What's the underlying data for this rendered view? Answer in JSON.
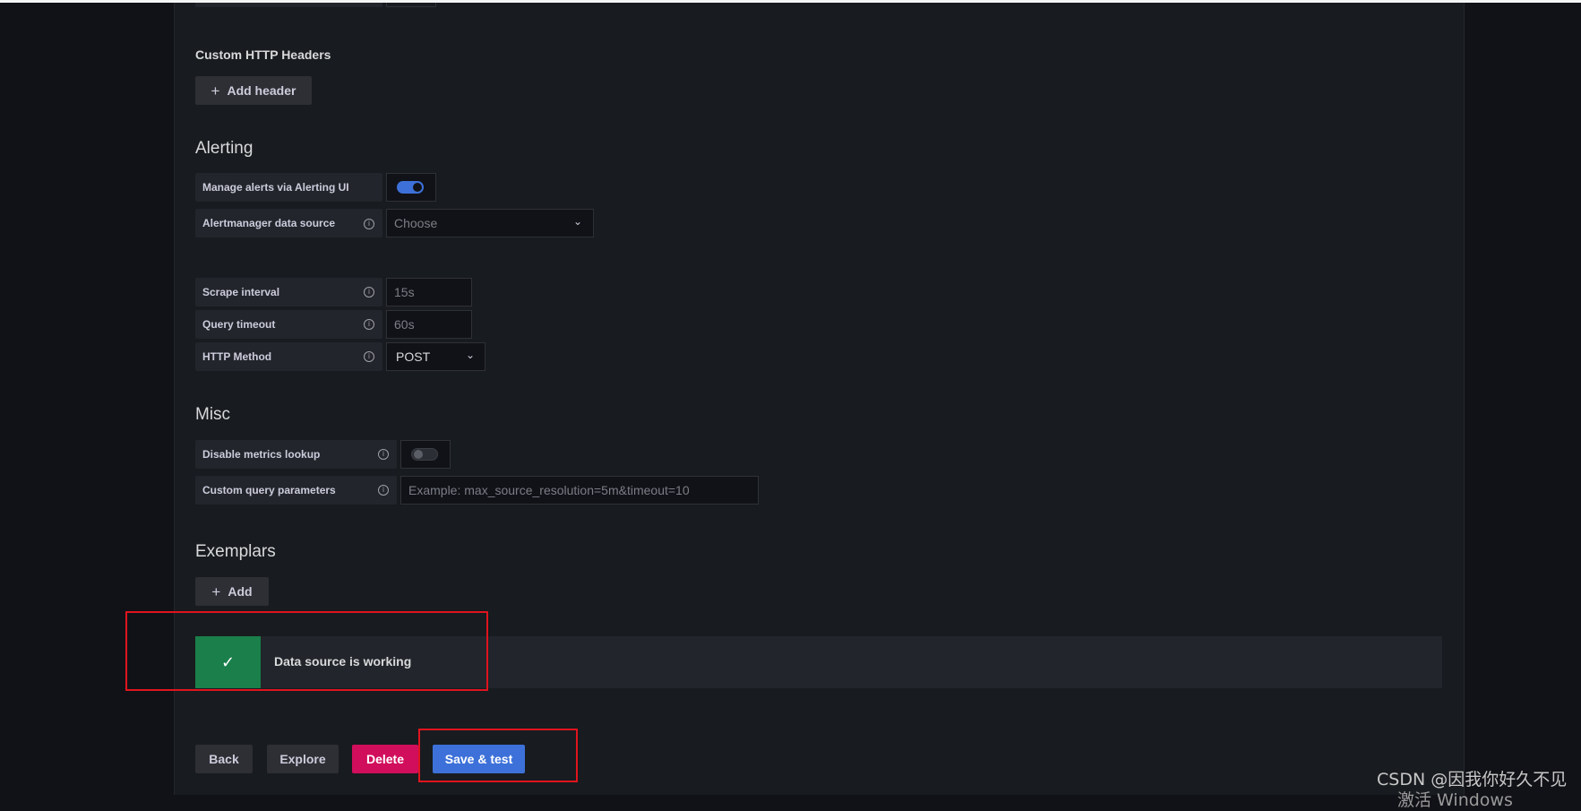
{
  "custom_headers": {
    "title": "Custom HTTP Headers",
    "add_label": "Add header"
  },
  "alerting": {
    "title": "Alerting",
    "manage_label": "Manage alerts via Alerting UI",
    "manage_enabled": true,
    "alertmanager_label": "Alertmanager data source",
    "alertmanager_placeholder": "Choose"
  },
  "settings": {
    "scrape_interval_label": "Scrape interval",
    "scrape_interval_placeholder": "15s",
    "query_timeout_label": "Query timeout",
    "query_timeout_placeholder": "60s",
    "http_method_label": "HTTP Method",
    "http_method_value": "POST"
  },
  "misc": {
    "title": "Misc",
    "disable_lookup_label": "Disable metrics lookup",
    "disable_lookup_enabled": false,
    "custom_query_label": "Custom query parameters",
    "custom_query_placeholder": "Example: max_source_resolution=5m&timeout=10"
  },
  "exemplars": {
    "title": "Exemplars",
    "add_label": "Add"
  },
  "status": {
    "message": "Data source is working",
    "icon": "check-icon"
  },
  "actions": {
    "back": "Back",
    "explore": "Explore",
    "delete": "Delete",
    "save_test": "Save & test"
  },
  "watermark": {
    "line1": "CSDN @因我你好久不见",
    "line2": "激活 Windows"
  },
  "colors": {
    "primary": "#3d71d9",
    "danger": "#d10e5c",
    "success": "#1a7f4b",
    "panel": "#181b1f",
    "background": "#111217"
  }
}
